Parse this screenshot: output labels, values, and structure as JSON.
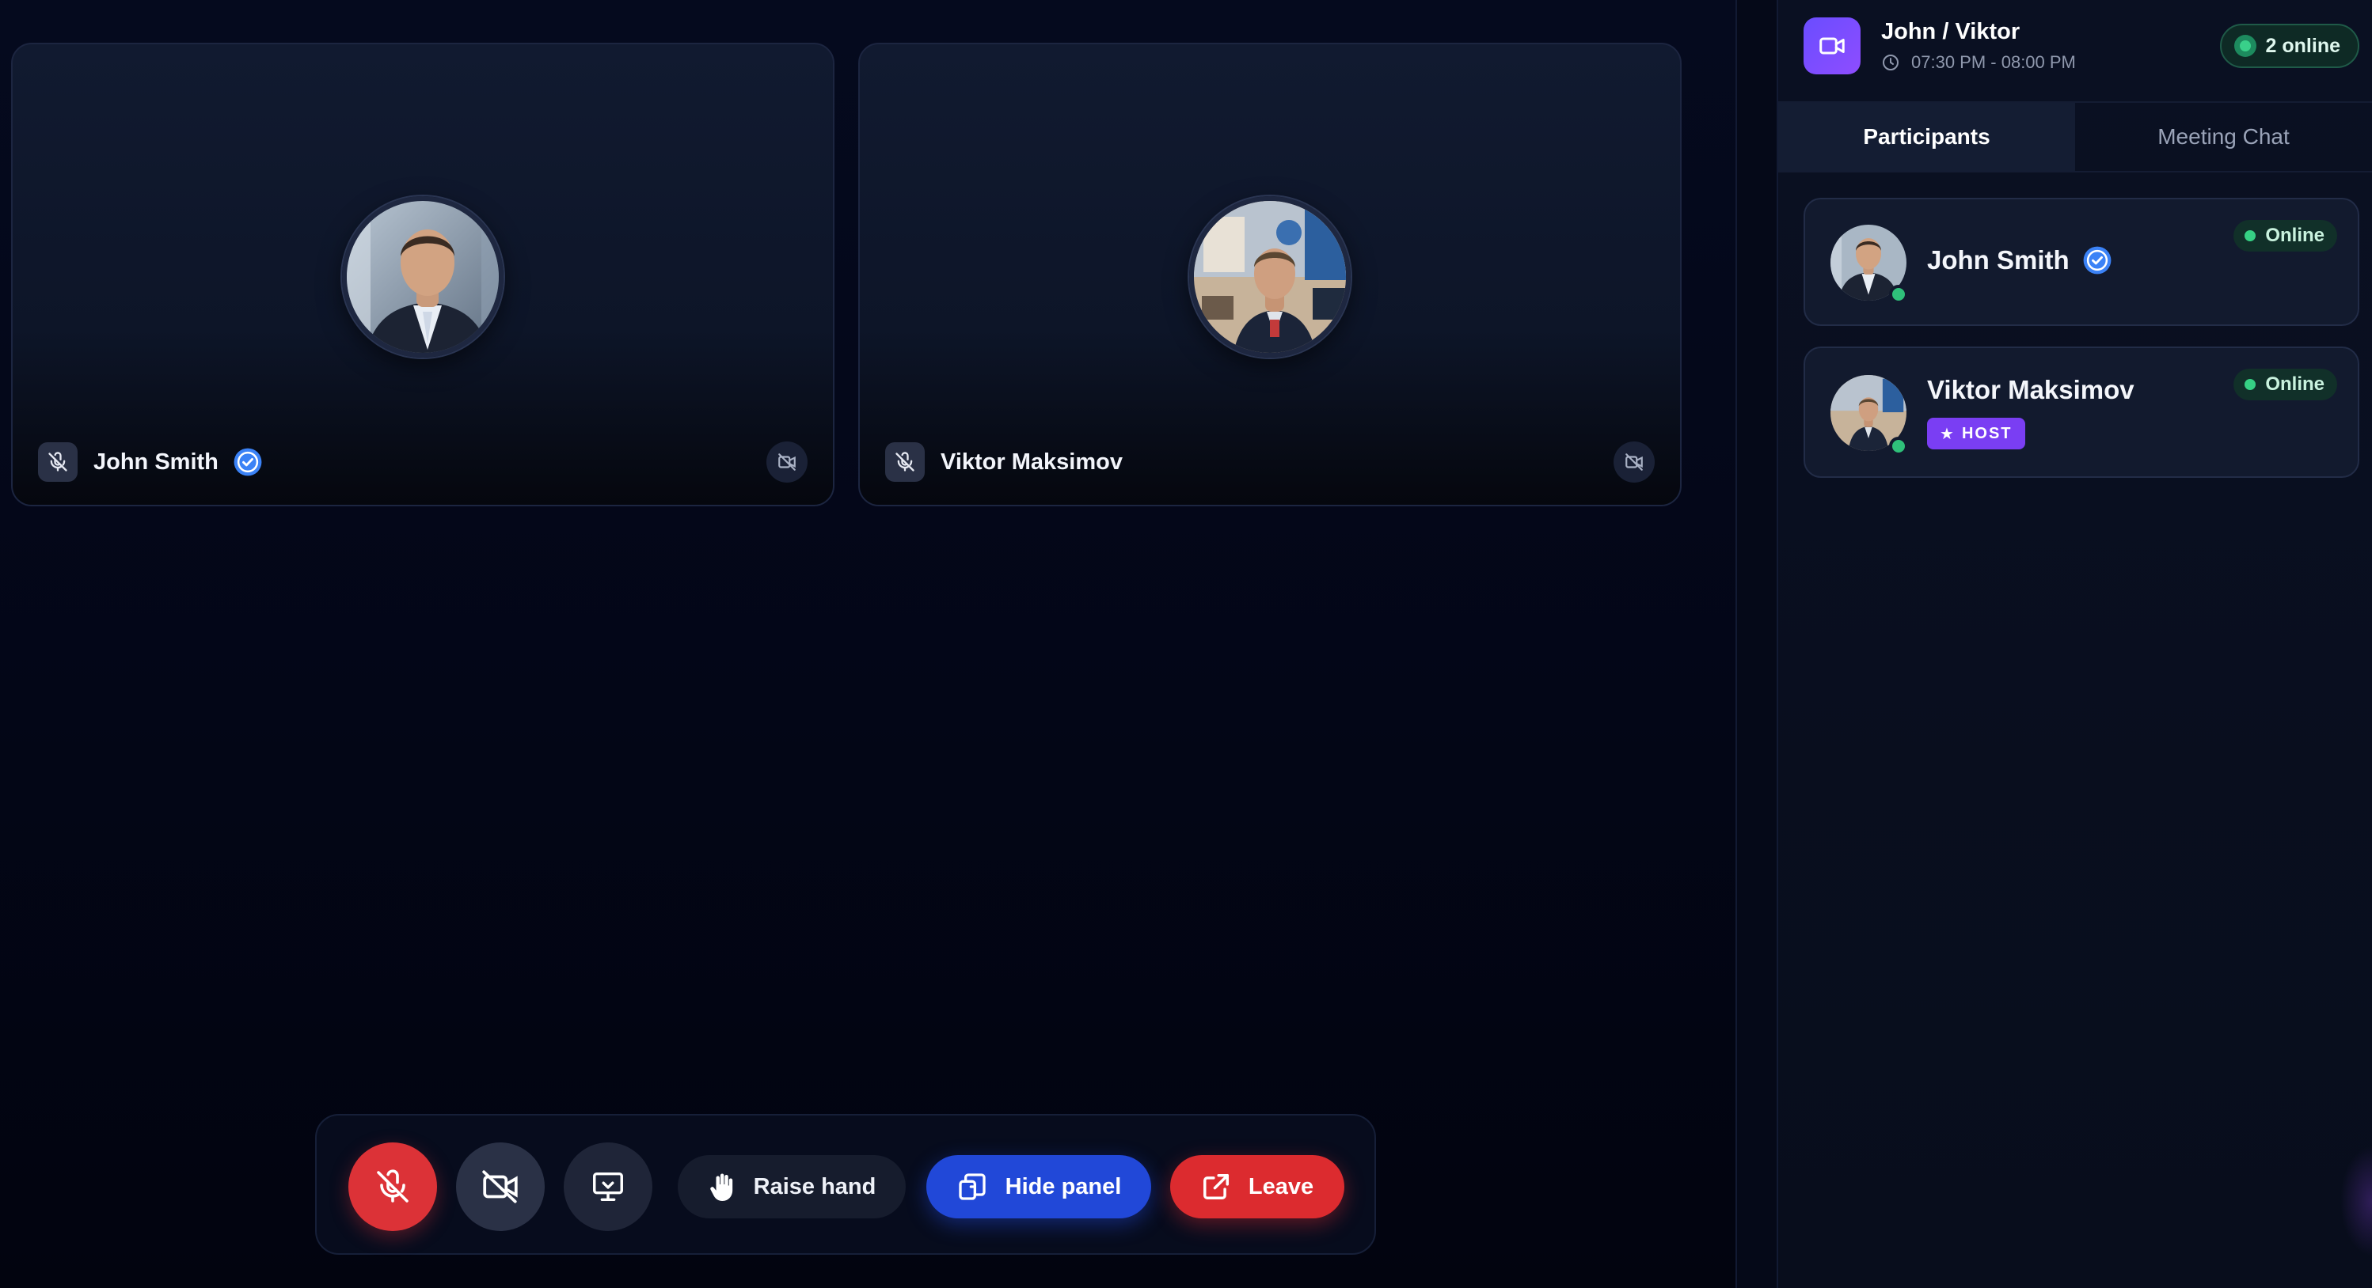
{
  "meeting": {
    "title": "John / Viktor",
    "time": "07:30 PM - 08:00 PM",
    "online_count": "2 online"
  },
  "tabs": [
    {
      "label": "Participants",
      "active": true
    },
    {
      "label": "Meeting Chat",
      "active": false
    }
  ],
  "tiles": [
    {
      "name": "John Smith",
      "verified": true,
      "mic": "muted",
      "camera": "off"
    },
    {
      "name": "Viktor Maksimov",
      "verified": false,
      "mic": "muted",
      "camera": "off"
    }
  ],
  "participants": [
    {
      "name": "John Smith",
      "verified": true,
      "status": "Online",
      "host": false
    },
    {
      "name": "Viktor Maksimov",
      "verified": false,
      "status": "Online",
      "host": true,
      "host_label": "HOST"
    }
  ],
  "controls": {
    "raise_hand": "Raise hand",
    "hide_panel": "Hide panel",
    "leave": "Leave"
  },
  "colors": {
    "background": "#030617",
    "accent_blue": "#2148d8",
    "danger_red": "#dc3237",
    "host_purple": "#7a3ef3",
    "online_green": "#36d184",
    "verified_blue": "#3b82f6"
  },
  "icons": [
    "mic-off-icon",
    "video-off-icon",
    "screen-share-icon",
    "hand-icon",
    "panel-icon",
    "leave-icon",
    "video-camera-icon",
    "clock-icon",
    "verified-icon",
    "star-icon"
  ]
}
